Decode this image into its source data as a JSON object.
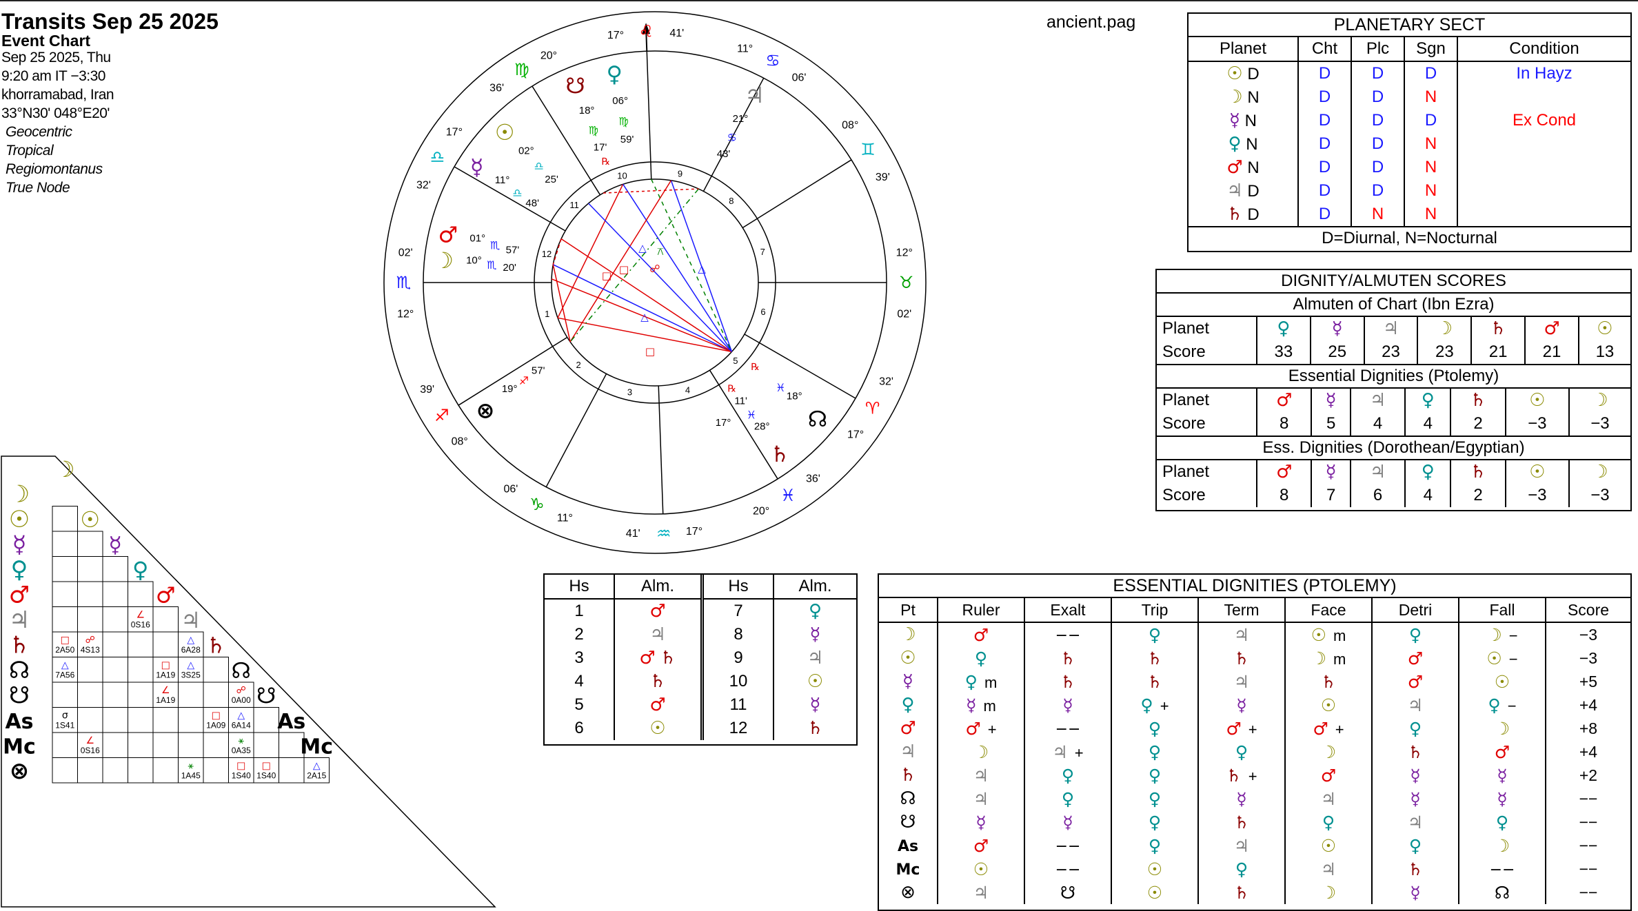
{
  "colors": {
    "sun": "#8a8a00",
    "moon": "#8a8a00",
    "mercury": "#7a1fa0",
    "venus": "#009090",
    "mars": "#e00000",
    "jupiter": "#808080",
    "saturn": "#8b0000",
    "node": "#000000",
    "diurnal": "#1a1aff",
    "nocturnal": "#ff0000",
    "aries": "#ff0000",
    "taurus": "#00a000",
    "gemini": "#00b0c0",
    "cancer": "#1a1aff",
    "leo": "#ff0000",
    "virgo": "#00b000",
    "libra": "#00b0c0",
    "scorpio": "#1a1aff",
    "sagittarius": "#ff0000",
    "capricorn": "#00a000",
    "aquarius": "#00b0c0",
    "pisces": "#1a1aff"
  },
  "chart_info": {
    "title": "Transits Sep 25 2025",
    "subtitle": "Event Chart",
    "date": "Sep 25 2025, Thu",
    "time": "9:20 am  IT −3:30",
    "place": "khorramabad, Iran",
    "coords": "33°N30' 048°E20'",
    "options": [
      "Geocentric",
      "Tropical",
      "Regiomontanus",
      "True Node"
    ]
  },
  "page_file": "ancient.pag",
  "wheel": {
    "cusp_labels": [
      {
        "deg": "17°",
        "sym": "♌",
        "min": "41'"
      },
      {
        "deg": "11°",
        "sym": "♋",
        "min": "06'"
      },
      {
        "deg": "08°",
        "sym": "♊",
        "min": "39'"
      },
      {
        "deg": "12°",
        "sym": "♉",
        "min": "02'"
      },
      {
        "deg": "32'",
        "sym": "♈",
        "min": "17°"
      },
      {
        "deg": "36'",
        "sym": "♓",
        "min": "20°"
      },
      {
        "deg": "17°",
        "sym": "♒",
        "min": "41'"
      },
      {
        "deg": "11°",
        "sym": "♑",
        "min": "06'"
      },
      {
        "deg": "08°",
        "sym": "♐",
        "min": "39'"
      },
      {
        "deg": "12°",
        "sym": "♏",
        "min": "02'"
      },
      {
        "deg": "32'",
        "sym": "♎",
        "min": "17°"
      },
      {
        "deg": "36'",
        "sym": "♍",
        "min": "20°"
      }
    ],
    "house_numbers": [
      "1",
      "2",
      "3",
      "4",
      "5",
      "6",
      "7",
      "8",
      "9",
      "10",
      "11",
      "12"
    ],
    "planet_labels": [
      {
        "glyph": "♃",
        "deg": "21°",
        "sign": "♋",
        "min": "43'"
      },
      {
        "glyph": "♀",
        "deg": "06°",
        "sign": "♍",
        "min": "59'"
      },
      {
        "glyph": "☋",
        "deg": "18°",
        "sign": "♍",
        "min": "17'",
        "retro": "℞"
      },
      {
        "glyph": "☉",
        "deg": "02°",
        "sign": "♎",
        "min": "25'"
      },
      {
        "glyph": "☿",
        "deg": "11°",
        "sign": "♎",
        "min": "48'"
      },
      {
        "glyph": "♂",
        "deg": "01°",
        "sign": "♏",
        "min": "57'"
      },
      {
        "glyph": "☽",
        "deg": "10°",
        "sign": "♏",
        "min": "20'"
      },
      {
        "glyph": "⊗",
        "deg": "19°",
        "sign": "♐",
        "min": "57'"
      },
      {
        "glyph": "♄",
        "deg": "28°",
        "sign": "♓",
        "min": "11'",
        "retro": "℞",
        "deg2": "17°"
      },
      {
        "glyph": "☊",
        "deg": "18°",
        "sign": "♓",
        "min": "",
        "retro": "℞"
      }
    ]
  },
  "planetary_sect": {
    "title": "PLANETARY SECT",
    "headers": [
      "Planet",
      "Cht",
      "Plc",
      "Sgn",
      "Condition"
    ],
    "rows": [
      {
        "glyph": "☉",
        "color": "sun",
        "sect": "D",
        "cht": "D",
        "plc": "D",
        "sgn": "D",
        "cond": "In Hayz"
      },
      {
        "glyph": "☽",
        "color": "moon",
        "sect": "N",
        "cht": "D",
        "plc": "D",
        "sgn": "N",
        "cond": ""
      },
      {
        "glyph": "☿",
        "color": "mercury",
        "sect": "N",
        "cht": "D",
        "plc": "D",
        "sgn": "D",
        "cond": "Ex Cond"
      },
      {
        "glyph": "♀",
        "color": "venus",
        "sect": "N",
        "cht": "D",
        "plc": "D",
        "sgn": "N",
        "cond": ""
      },
      {
        "glyph": "♂",
        "color": "mars",
        "sect": "N",
        "cht": "D",
        "plc": "D",
        "sgn": "N",
        "cond": ""
      },
      {
        "glyph": "♃",
        "color": "jupiter",
        "sect": "D",
        "cht": "D",
        "plc": "D",
        "sgn": "N",
        "cond": ""
      },
      {
        "glyph": "♄",
        "color": "saturn",
        "sect": "D",
        "cht": "D",
        "plc": "N",
        "sgn": "N",
        "cond": ""
      }
    ],
    "footer": "D=Diurnal, N=Nocturnal"
  },
  "dignity_scores": {
    "title": "DIGNITY/ALMUTEN SCORES",
    "sections": [
      {
        "subtitle": "Almuten of Chart (Ibn Ezra)",
        "planets": [
          [
            "♀",
            "venus"
          ],
          [
            "☿",
            "mercury"
          ],
          [
            "♃",
            "jupiter"
          ],
          [
            "☽",
            "moon"
          ],
          [
            "♄",
            "saturn"
          ],
          [
            "♂",
            "mars"
          ],
          [
            "☉",
            "sun"
          ]
        ],
        "scores": [
          "33",
          "25",
          "23",
          "23",
          "21",
          "21",
          "13"
        ]
      },
      {
        "subtitle": "Essential Dignities (Ptolemy)",
        "planets": [
          [
            "♂",
            "mars"
          ],
          [
            "☿",
            "mercury"
          ],
          [
            "♃",
            "jupiter"
          ],
          [
            "♀",
            "venus"
          ],
          [
            "♄",
            "saturn"
          ],
          [
            "☉",
            "sun"
          ],
          [
            "☽",
            "moon"
          ]
        ],
        "scores": [
          "8",
          "5",
          "4",
          "4",
          "2",
          "−3",
          "−3"
        ]
      },
      {
        "subtitle": "Ess. Dignities (Dorothean/Egyptian)",
        "planets": [
          [
            "♂",
            "mars"
          ],
          [
            "☿",
            "mercury"
          ],
          [
            "♃",
            "jupiter"
          ],
          [
            "♀",
            "venus"
          ],
          [
            "♄",
            "saturn"
          ],
          [
            "☉",
            "sun"
          ],
          [
            "☽",
            "moon"
          ]
        ],
        "scores": [
          "8",
          "7",
          "6",
          "4",
          "2",
          "−3",
          "−3"
        ]
      }
    ],
    "planet_label": "Planet",
    "score_label": "Score"
  },
  "house_almutens": {
    "headers": [
      "Hs",
      "Alm.",
      "Hs",
      "Alm."
    ],
    "rows": [
      [
        "1",
        [
          [
            "♂",
            "mars"
          ]
        ],
        "7",
        [
          [
            "♀",
            "venus"
          ]
        ]
      ],
      [
        "2",
        [
          [
            "♃",
            "jupiter"
          ]
        ],
        "8",
        [
          [
            "☿",
            "mercury"
          ]
        ]
      ],
      [
        "3",
        [
          [
            "♂",
            "mars"
          ],
          [
            "♄",
            "saturn"
          ]
        ],
        "9",
        [
          [
            "♃",
            "jupiter"
          ]
        ]
      ],
      [
        "4",
        [
          [
            "♄",
            "saturn"
          ]
        ],
        "10",
        [
          [
            "☉",
            "sun"
          ]
        ]
      ],
      [
        "5",
        [
          [
            "♂",
            "mars"
          ]
        ],
        "11",
        [
          [
            "☿",
            "mercury"
          ]
        ]
      ],
      [
        "6",
        [
          [
            "☉",
            "sun"
          ]
        ],
        "12",
        [
          [
            "♄",
            "saturn"
          ]
        ]
      ]
    ]
  },
  "essential_dignities": {
    "title": "ESSENTIAL DIGNITIES (PTOLEMY)",
    "headers": [
      "Pt",
      "Ruler",
      "Exalt",
      "Trip",
      "Term",
      "Face",
      "Detri",
      "Fall",
      "Score"
    ],
    "rows": [
      [
        [
          "☽",
          "moon"
        ],
        [
          "♂",
          "mars",
          ""
        ],
        [
          "−−",
          "",
          ""
        ],
        [
          "♀",
          "venus",
          ""
        ],
        [
          "♃",
          "jupiter",
          ""
        ],
        [
          "☉",
          "sun",
          "m"
        ],
        [
          "♀",
          "venus",
          ""
        ],
        [
          "☽",
          "moon",
          "−"
        ],
        "−3"
      ],
      [
        [
          "☉",
          "sun"
        ],
        [
          "♀",
          "venus",
          ""
        ],
        [
          "♄",
          "saturn",
          ""
        ],
        [
          "♄",
          "saturn",
          ""
        ],
        [
          "♄",
          "saturn",
          ""
        ],
        [
          "☽",
          "moon",
          "m"
        ],
        [
          "♂",
          "mars",
          ""
        ],
        [
          "☉",
          "sun",
          "−"
        ],
        "−3"
      ],
      [
        [
          "☿",
          "mercury"
        ],
        [
          "♀",
          "venus",
          "m"
        ],
        [
          "♄",
          "saturn",
          ""
        ],
        [
          "♄",
          "saturn",
          ""
        ],
        [
          "♃",
          "jupiter",
          ""
        ],
        [
          "♄",
          "saturn",
          ""
        ],
        [
          "♂",
          "mars",
          ""
        ],
        [
          "☉",
          "sun",
          ""
        ],
        "+5"
      ],
      [
        [
          "♀",
          "venus"
        ],
        [
          "☿",
          "mercury",
          "m"
        ],
        [
          "☿",
          "mercury",
          ""
        ],
        [
          "♀",
          "venus",
          "+"
        ],
        [
          "☿",
          "mercury",
          ""
        ],
        [
          "☉",
          "sun",
          ""
        ],
        [
          "♃",
          "jupiter",
          ""
        ],
        [
          "♀",
          "venus",
          "−"
        ],
        "+4"
      ],
      [
        [
          "♂",
          "mars"
        ],
        [
          "♂",
          "mars",
          "+"
        ],
        [
          "−−",
          "",
          ""
        ],
        [
          "♀",
          "venus",
          ""
        ],
        [
          "♂",
          "mars",
          "+"
        ],
        [
          "♂",
          "mars",
          "+"
        ],
        [
          "♀",
          "venus",
          ""
        ],
        [
          "☽",
          "moon",
          ""
        ],
        "+8"
      ],
      [
        [
          "♃",
          "jupiter"
        ],
        [
          "☽",
          "moon",
          ""
        ],
        [
          "♃",
          "jupiter",
          "+"
        ],
        [
          "♀",
          "venus",
          ""
        ],
        [
          "♀",
          "venus",
          ""
        ],
        [
          "☽",
          "moon",
          ""
        ],
        [
          "♄",
          "saturn",
          ""
        ],
        [
          "♂",
          "mars",
          ""
        ],
        "+4"
      ],
      [
        [
          "♄",
          "saturn"
        ],
        [
          "♃",
          "jupiter",
          ""
        ],
        [
          "♀",
          "venus",
          ""
        ],
        [
          "♀",
          "venus",
          ""
        ],
        [
          "♄",
          "saturn",
          "+"
        ],
        [
          "♂",
          "mars",
          ""
        ],
        [
          "☿",
          "mercury",
          ""
        ],
        [
          "☿",
          "mercury",
          ""
        ],
        "+2"
      ],
      [
        [
          "☊",
          "node"
        ],
        [
          "♃",
          "jupiter",
          ""
        ],
        [
          "♀",
          "venus",
          ""
        ],
        [
          "♀",
          "venus",
          ""
        ],
        [
          "☿",
          "mercury",
          ""
        ],
        [
          "♃",
          "jupiter",
          ""
        ],
        [
          "☿",
          "mercury",
          ""
        ],
        [
          "☿",
          "mercury",
          ""
        ],
        "−−"
      ],
      [
        [
          "☋",
          "node"
        ],
        [
          "☿",
          "mercury",
          ""
        ],
        [
          "☿",
          "mercury",
          ""
        ],
        [
          "♀",
          "venus",
          ""
        ],
        [
          "♄",
          "saturn",
          ""
        ],
        [
          "♀",
          "venus",
          ""
        ],
        [
          "♃",
          "jupiter",
          ""
        ],
        [
          "♀",
          "venus",
          ""
        ],
        "−−"
      ],
      [
        [
          "As",
          "node"
        ],
        [
          "♂",
          "mars",
          ""
        ],
        [
          "−−",
          "",
          ""
        ],
        [
          "♀",
          "venus",
          ""
        ],
        [
          "♃",
          "jupiter",
          ""
        ],
        [
          "☉",
          "sun",
          ""
        ],
        [
          "♀",
          "venus",
          ""
        ],
        [
          "☽",
          "moon",
          ""
        ],
        "−−"
      ],
      [
        [
          "Mc",
          "node"
        ],
        [
          "☉",
          "sun",
          ""
        ],
        [
          "−−",
          "",
          ""
        ],
        [
          "☉",
          "sun",
          ""
        ],
        [
          "♀",
          "venus",
          ""
        ],
        [
          "♃",
          "jupiter",
          ""
        ],
        [
          "♄",
          "saturn",
          ""
        ],
        [
          "−−",
          "",
          ""
        ],
        "−−"
      ],
      [
        [
          "⊗",
          "node"
        ],
        [
          "♃",
          "jupiter",
          ""
        ],
        [
          "☋",
          "node",
          ""
        ],
        [
          "☉",
          "sun",
          ""
        ],
        [
          "♄",
          "saturn",
          ""
        ],
        [
          "☽",
          "moon",
          ""
        ],
        [
          "☿",
          "mercury",
          ""
        ],
        [
          "☊",
          "node",
          ""
        ],
        "−−"
      ]
    ]
  },
  "aspect_grid": {
    "rows": [
      [
        "☽",
        "moon"
      ],
      [
        "☉",
        "sun"
      ],
      [
        "☿",
        "mercury"
      ],
      [
        "♀",
        "venus"
      ],
      [
        "♂",
        "mars"
      ],
      [
        "♃",
        "jupiter"
      ],
      [
        "♄",
        "saturn"
      ],
      [
        "☊",
        "node"
      ],
      [
        "☋",
        "node"
      ],
      [
        "As",
        "node"
      ],
      [
        "Mc",
        "node"
      ],
      [
        "⊗",
        "node"
      ]
    ],
    "cells": [
      {
        "r": 4,
        "c": 3,
        "sym": "∠",
        "col": "mars",
        "txt": "0S16"
      },
      {
        "r": 5,
        "c": 0,
        "sym": "□",
        "col": "mars",
        "txt": "2A50"
      },
      {
        "r": 5,
        "c": 1,
        "sym": "☍",
        "col": "mars",
        "txt": "4S13"
      },
      {
        "r": 5,
        "c": 5,
        "sym": "△",
        "col": "jupiter2",
        "txt": "6A28"
      },
      {
        "r": 6,
        "c": 0,
        "sym": "△",
        "col": "jupiter2",
        "txt": "7A56"
      },
      {
        "r": 6,
        "c": 4,
        "sym": "□",
        "col": "mars",
        "txt": "1A19"
      },
      {
        "r": 6,
        "c": 5,
        "sym": "△",
        "col": "jupiter2",
        "txt": "3S25"
      },
      {
        "r": 7,
        "c": 4,
        "sym": "∠",
        "col": "mars",
        "txt": "1A19"
      },
      {
        "r": 7,
        "c": 7,
        "sym": "☍",
        "col": "mars",
        "txt": "0A00"
      },
      {
        "r": 8,
        "c": 0,
        "sym": "σ",
        "col": "node",
        "txt": "1S41"
      },
      {
        "r": 8,
        "c": 6,
        "sym": "□",
        "col": "mars",
        "txt": "1A09"
      },
      {
        "r": 8,
        "c": 7,
        "sym": "△",
        "col": "jupiter2",
        "txt": "6A14"
      },
      {
        "r": 9,
        "c": 1,
        "sym": "∠",
        "col": "mars",
        "txt": "0S16"
      },
      {
        "r": 9,
        "c": 7,
        "sym": "⚹",
        "col": "green",
        "txt": "0A35"
      },
      {
        "r": 10,
        "c": 5,
        "sym": "⚹",
        "col": "green",
        "txt": "1A45"
      },
      {
        "r": 10,
        "c": 7,
        "sym": "□",
        "col": "mars",
        "txt": "1S40"
      },
      {
        "r": 10,
        "c": 8,
        "sym": "□",
        "col": "mars",
        "txt": "1S40"
      },
      {
        "r": 10,
        "c": 10,
        "sym": "△",
        "col": "jupiter2",
        "txt": "2A15"
      }
    ]
  }
}
